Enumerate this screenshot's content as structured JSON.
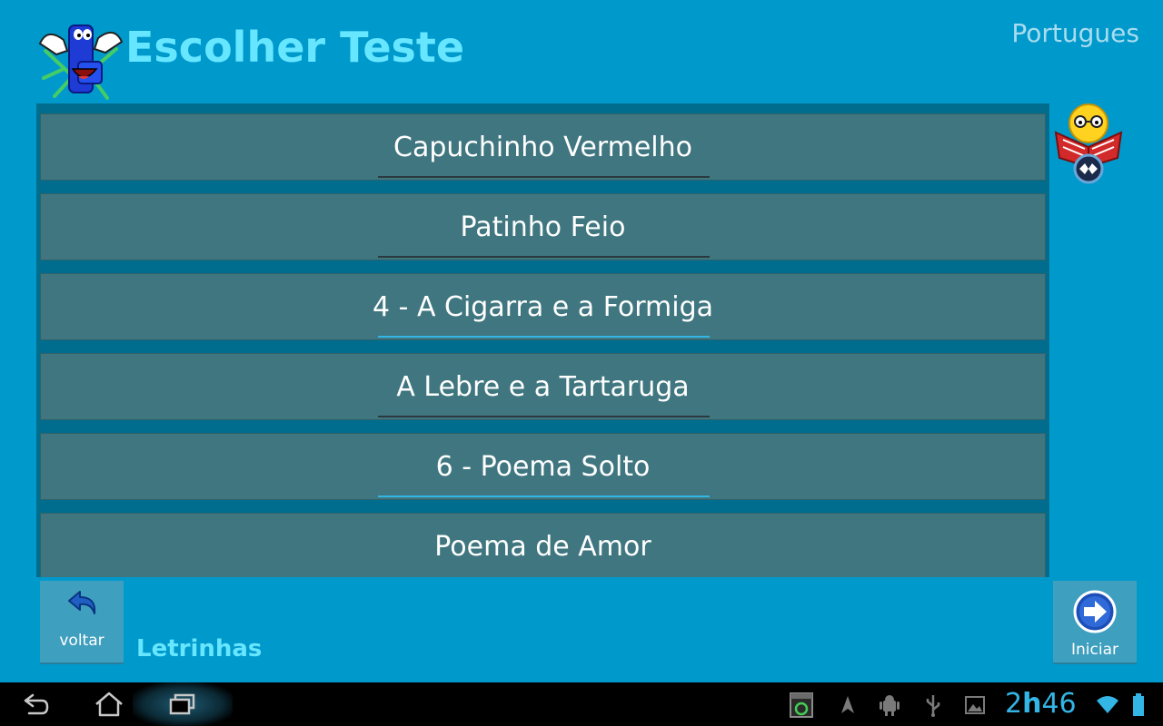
{
  "header": {
    "title": "Escolher Teste",
    "language": "Portugues"
  },
  "tests": [
    {
      "label": "Capuchinho Vermelho",
      "highlighted": false
    },
    {
      "label": "Patinho Feio",
      "highlighted": false
    },
    {
      "label": "4 - A Cigarra e a Formiga",
      "highlighted": true
    },
    {
      "label": "A Lebre e a Tartaruga",
      "highlighted": false
    },
    {
      "label": "6 - Poema Solto",
      "highlighted": true
    },
    {
      "label": "Poema de Amor",
      "highlighted": false
    }
  ],
  "footer": {
    "back_label": "voltar",
    "app_name": "Letrinhas",
    "start_label": "Iniciar"
  },
  "system_bar": {
    "clock_hour": "2",
    "clock_sep": "h",
    "clock_min": "46",
    "icons": [
      "back-nav-icon",
      "home-nav-icon",
      "recent-apps-icon",
      "screenshot-icon",
      "location-icon",
      "android-debug-icon",
      "usb-icon",
      "gallery-icon",
      "wifi-icon",
      "battery-icon"
    ]
  },
  "colors": {
    "background": "#0099cc",
    "title": "#66e6ff",
    "list_item": "#3f767f",
    "accent": "#33b5e5"
  }
}
